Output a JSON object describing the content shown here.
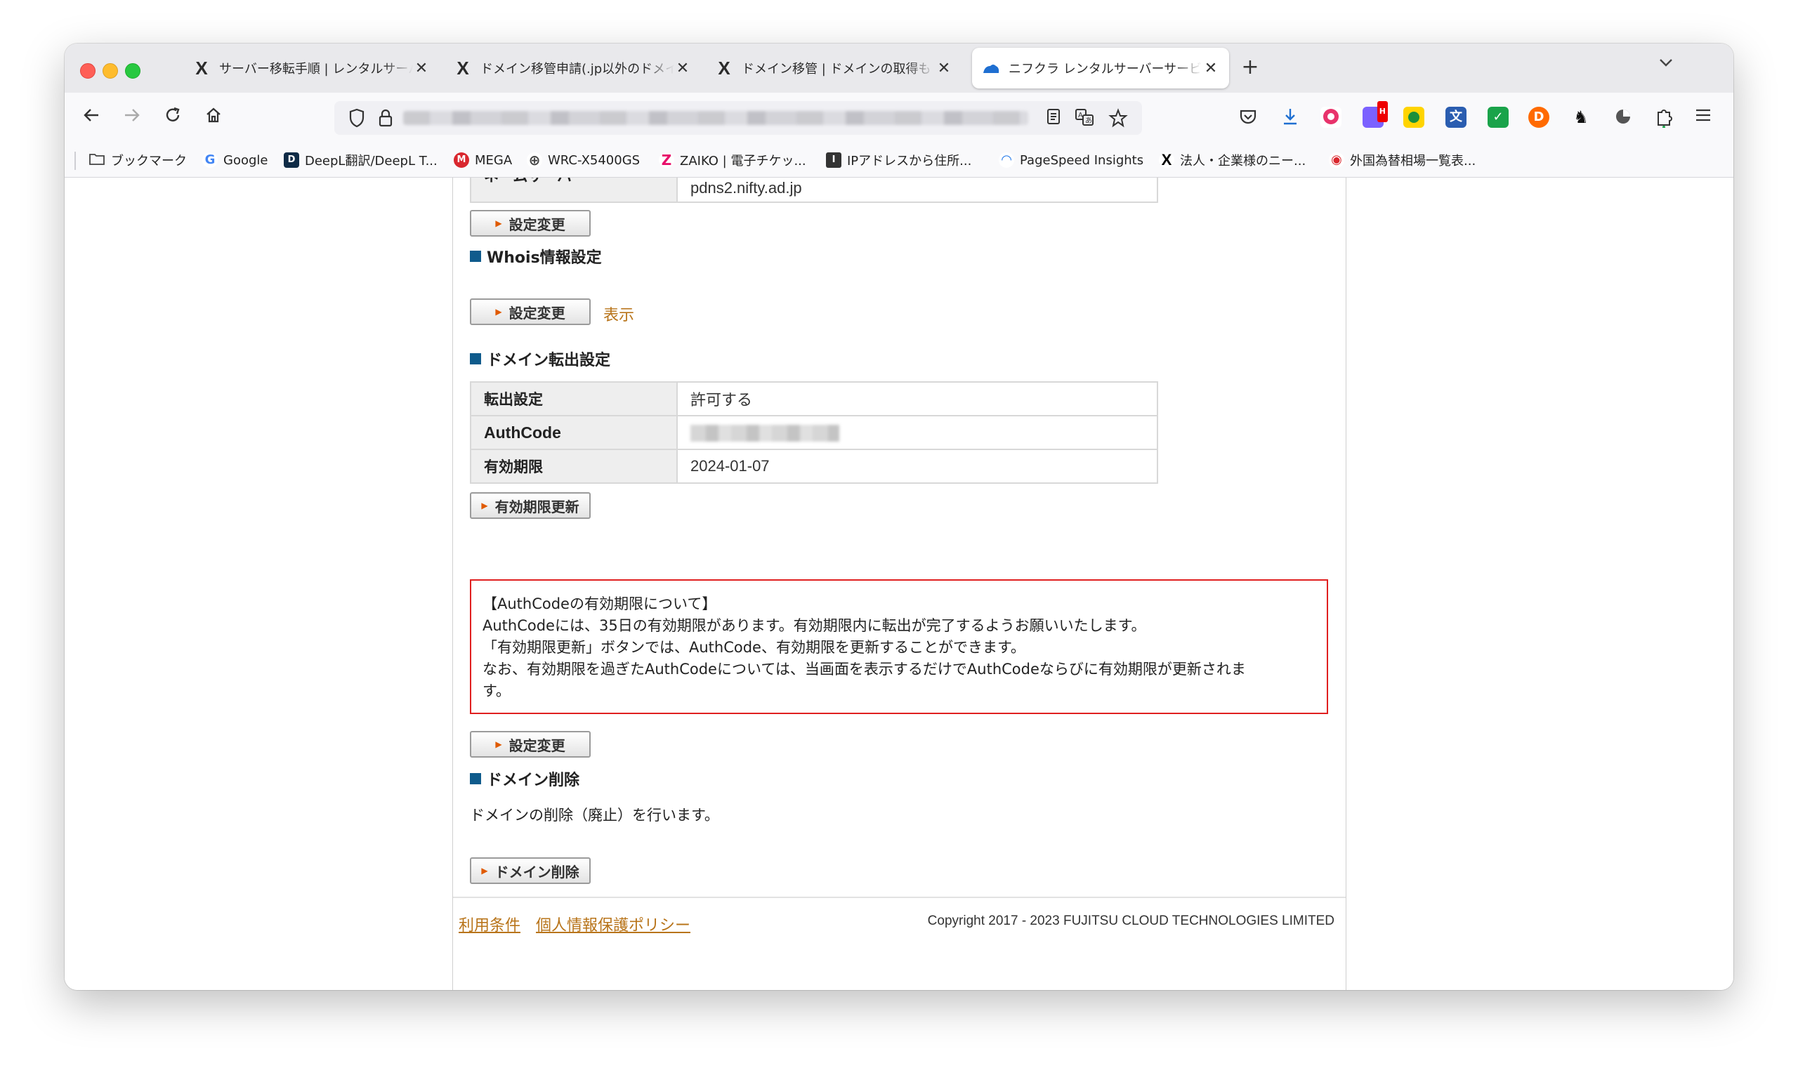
{
  "browser": {
    "tabs": [
      {
        "icon": "x-icon",
        "favicon_text": "X",
        "title": "サーバー移転手順 | レンタルサーバー",
        "active": false
      },
      {
        "icon": "x-icon",
        "favicon_text": "X",
        "title": "ドメイン移管申請(.jp以外のドメイン)",
        "active": false
      },
      {
        "icon": "x-icon",
        "favicon_text": "X",
        "title": "ドメイン移管 | ドメインの取得も",
        "active": false
      },
      {
        "icon": "nifcloud-icon",
        "favicon_text": "",
        "title": "ニフクラ レンタルサーバーサービス",
        "active": true
      }
    ],
    "new_tab": "+",
    "close_glyph": "✕",
    "bookmarks": [
      {
        "label": "ブックマーク",
        "icon": "folder-icon",
        "color": "#555555",
        "glyph": ""
      },
      {
        "label": "Google",
        "icon": "google-icon",
        "color": "#4285f4",
        "glyph": "G"
      },
      {
        "label": "DeepL翻訳/DeepL T...",
        "icon": "deepl-icon",
        "color": "#0f2b46",
        "glyph": "D"
      },
      {
        "label": "MEGA",
        "icon": "mega-icon",
        "color": "#d9272e",
        "glyph": "M"
      },
      {
        "label": "WRC-X5400GS",
        "icon": "globe-icon",
        "color": "#555555",
        "glyph": "⊕"
      },
      {
        "label": "ZAIKO | 電子チケッ...",
        "icon": "zaiko-icon",
        "color": "#e8106b",
        "glyph": "Z"
      },
      {
        "label": "IPアドレスから住所...",
        "icon": "ip-icon",
        "color": "#333333",
        "glyph": "I"
      },
      {
        "label": "PageSpeed Insights",
        "icon": "pagespeed-icon",
        "color": "#1a73e8",
        "glyph": "◠"
      },
      {
        "label": "法人・企業様のニー...",
        "icon": "x-icon",
        "color": "#000000",
        "glyph": "X"
      },
      {
        "label": "外国為替相場一覧表...",
        "icon": "mufg-icon",
        "color": "#d9272e",
        "glyph": "◉"
      }
    ]
  },
  "page": {
    "nameserver": {
      "label": "ネームサーバー",
      "value": "pdns2.nifty.ad.jp"
    },
    "button_change": "設定変更",
    "whois": {
      "heading": "Whois情報設定",
      "link": "表示"
    },
    "transfer": {
      "heading": "ドメイン転出設定",
      "rows": [
        {
          "label": "転出設定",
          "value": "許可する"
        },
        {
          "label": "AuthCode",
          "value": ""
        },
        {
          "label": "有効期限",
          "value": "2024-01-07"
        }
      ],
      "renew_button": "有効期限更新"
    },
    "notice": {
      "lines": [
        "【AuthCodeの有効期限について】",
        "AuthCodeには、35日の有効期限があります。有効期限内に転出が完了するようお願いいたします。",
        "「有効期限更新」ボタンでは、AuthCode、有効期限を更新することができます。",
        "なお、有効期限を過ぎたAuthCodeについては、当画面を表示するだけでAuthCodeならびに有効期限が更新されま",
        "す。"
      ]
    },
    "delete": {
      "heading": "ドメイン削除",
      "description": "ドメインの削除（廃止）を行います。",
      "button": "ドメイン削除"
    },
    "footer": {
      "terms": "利用条件",
      "privacy": "個人情報保護ポリシー",
      "copyright": "Copyright 2017 - 2023 FUJITSU CLOUD TECHNOLOGIES LIMITED"
    }
  },
  "colors": {
    "accent_link": "#b8741a",
    "section_square": "#0f5b8c",
    "notice_border": "#e02020"
  }
}
